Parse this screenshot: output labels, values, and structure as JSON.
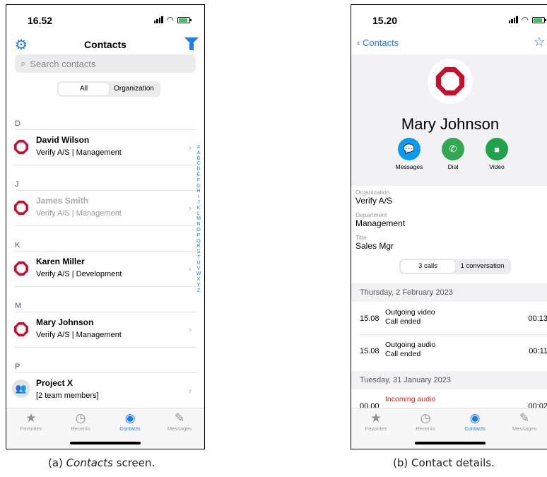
{
  "left": {
    "status_time": "16.52",
    "title": "Contacts",
    "search_placeholder": "Search contacts",
    "segments": [
      "All",
      "Organization"
    ],
    "sections": [
      "D",
      "J",
      "K",
      "M",
      "P"
    ],
    "contacts": [
      {
        "name": "David Wilson",
        "org": "Verify A/S | Management"
      },
      {
        "name": "James Smith",
        "org": "Verify A/S | Management"
      },
      {
        "name": "Karen Miller",
        "org": "Verify A/S | Development"
      },
      {
        "name": "Mary Johnson",
        "org": "Verify A/S | Management"
      },
      {
        "name": "Project X",
        "org": "[2 team members]"
      }
    ],
    "index_letters": [
      "#",
      "A",
      "B",
      "C",
      "D",
      "E",
      "F",
      "G",
      "H",
      "I",
      "J",
      "K",
      "L",
      "M",
      "N",
      "O",
      "P",
      "Q",
      "R",
      "S",
      "T",
      "U",
      "V",
      "W",
      "X",
      "Y",
      "Z"
    ]
  },
  "tabs": [
    "Favorites",
    "Recents",
    "Contacts",
    "Messages"
  ],
  "right": {
    "status_time": "15.20",
    "back_label": "Contacts",
    "name": "Mary Johnson",
    "actions": [
      "Messages",
      "Dial",
      "Video"
    ],
    "fields": [
      {
        "label": "Organization",
        "value": "Verify A/S"
      },
      {
        "label": "Department",
        "value": "Management"
      },
      {
        "label": "Title",
        "value": "Sales Mgr"
      }
    ],
    "segments": [
      "3 calls",
      "1 conversation"
    ],
    "group1_date": "Thursday, 2 February 2023",
    "calls": [
      {
        "time": "15.08",
        "type": "Outgoing video",
        "status": "Call ended",
        "duration": "00:13"
      },
      {
        "time": "15.08",
        "type": "Outgoing audio",
        "status": "Call ended",
        "duration": "00:11"
      }
    ],
    "group2_date": "Tuesday, 31 January 2023",
    "partial_call": {
      "time": "00.00",
      "type": "Incoming audio",
      "duration": "00:02"
    }
  },
  "captions": {
    "a_prefix": "(a) ",
    "a_emph": "Contacts",
    "a_suffix": " screen.",
    "b": "(b) Contact details."
  },
  "colors": {
    "accent": "#1a7cf6",
    "logo_red": "#c8102e",
    "messages": "#0a9af0",
    "dial": "#33a852",
    "video": "#1fa34a",
    "missed": "#e0201a"
  }
}
